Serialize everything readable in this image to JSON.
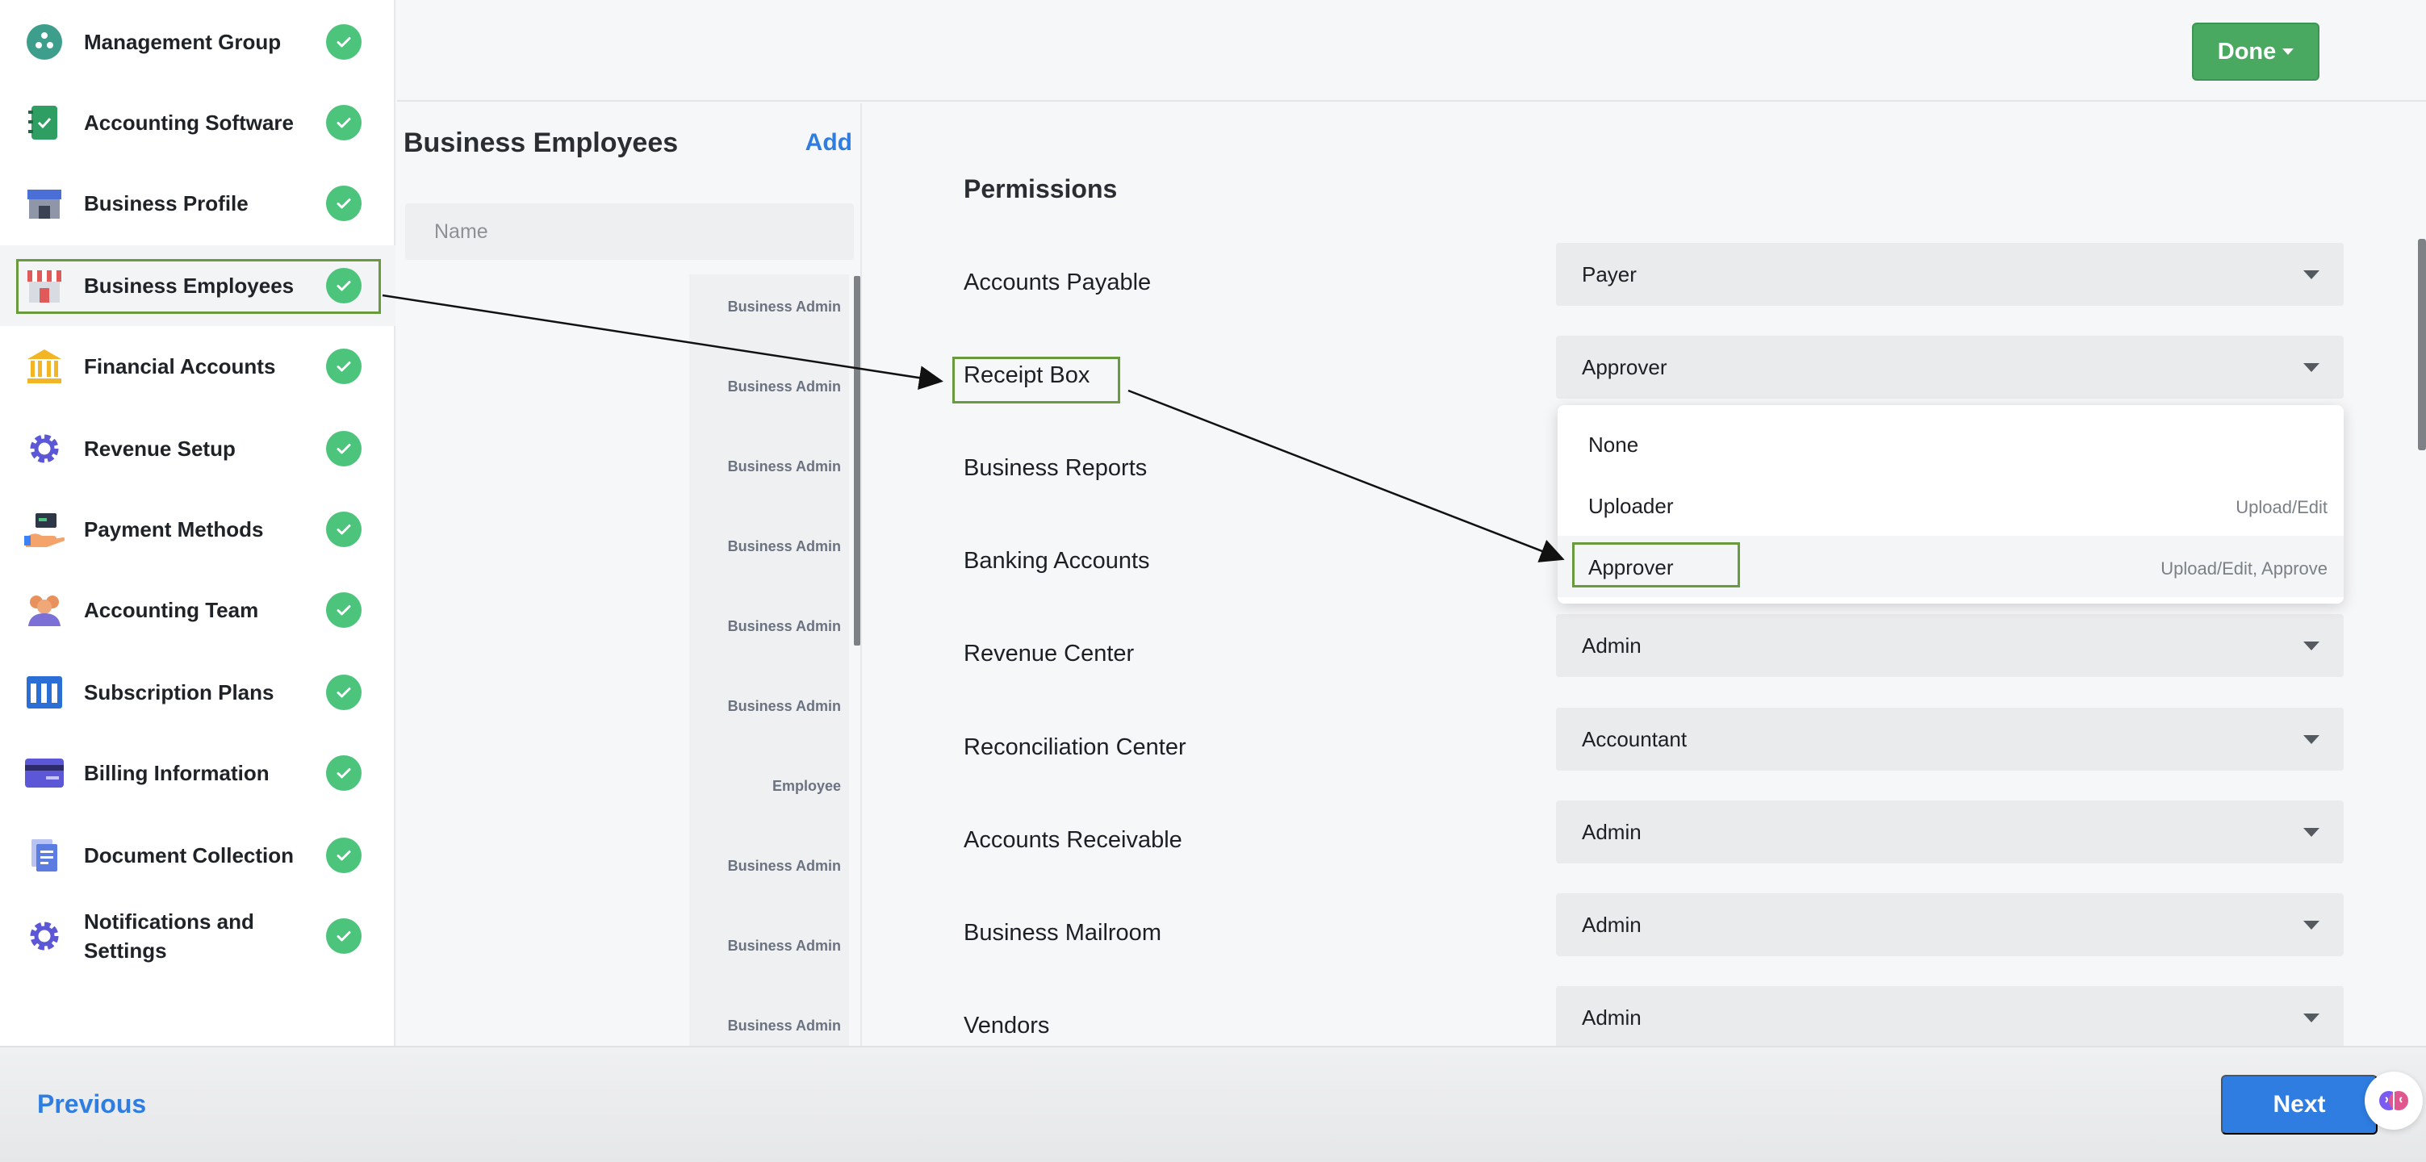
{
  "sidebar": {
    "items": [
      {
        "label": "Management Group",
        "icon": "management-group-icon"
      },
      {
        "label": "Accounting Software",
        "icon": "accounting-software-icon"
      },
      {
        "label": "Business Profile",
        "icon": "storefront-icon"
      },
      {
        "label": "Business Employees",
        "icon": "employees-store-icon",
        "active": true
      },
      {
        "label": "Financial Accounts",
        "icon": "bank-icon"
      },
      {
        "label": "Revenue Setup",
        "icon": "gear-icon"
      },
      {
        "label": "Payment Methods",
        "icon": "payment-hand-icon"
      },
      {
        "label": "Accounting Team",
        "icon": "team-icon"
      },
      {
        "label": "Subscription Plans",
        "icon": "plans-icon"
      },
      {
        "label": "Billing Information",
        "icon": "credit-card-icon"
      },
      {
        "label": "Document Collection",
        "icon": "document-icon"
      },
      {
        "label": "Notifications and Settings",
        "icon": "settings-gear-icon"
      }
    ],
    "status_icon": "check-circle-icon",
    "colors": {
      "check": "#4cc47c",
      "highlight": "#6a9a3e"
    }
  },
  "header": {
    "done_label": "Done"
  },
  "employees": {
    "title": "Business Employees",
    "add_label": "Add",
    "search_placeholder": "Name",
    "roles": [
      "Business Admin",
      "Business Admin",
      "Business Admin",
      "Business Admin",
      "Business Admin",
      "Business Admin",
      "Employee",
      "Business Admin",
      "Business Admin",
      "Business Admin"
    ]
  },
  "permissions": {
    "title": "Permissions",
    "rows": [
      {
        "label": "Accounts Payable",
        "value": "Payer"
      },
      {
        "label": "Receipt Box",
        "value": "Approver"
      },
      {
        "label": "Business Reports",
        "value": ""
      },
      {
        "label": "Banking Accounts",
        "value": ""
      },
      {
        "label": "Revenue Center",
        "value": "Admin"
      },
      {
        "label": "Reconciliation Center",
        "value": "Accountant"
      },
      {
        "label": "Accounts Receivable",
        "value": "Admin"
      },
      {
        "label": "Business Mailroom",
        "value": "Admin"
      },
      {
        "label": "Vendors",
        "value": "Admin"
      }
    ],
    "dropdown": {
      "options": [
        {
          "label": "None",
          "desc": ""
        },
        {
          "label": "Uploader",
          "desc": "Upload/Edit"
        },
        {
          "label": "Approver",
          "desc": "Upload/Edit, Approve",
          "selected": true
        }
      ]
    }
  },
  "footer": {
    "previous_label": "Previous",
    "next_label": "Next",
    "help_icon": "brain-assistant-icon"
  },
  "colors": {
    "primary": "#2f7de1",
    "done": "#4aa960"
  }
}
